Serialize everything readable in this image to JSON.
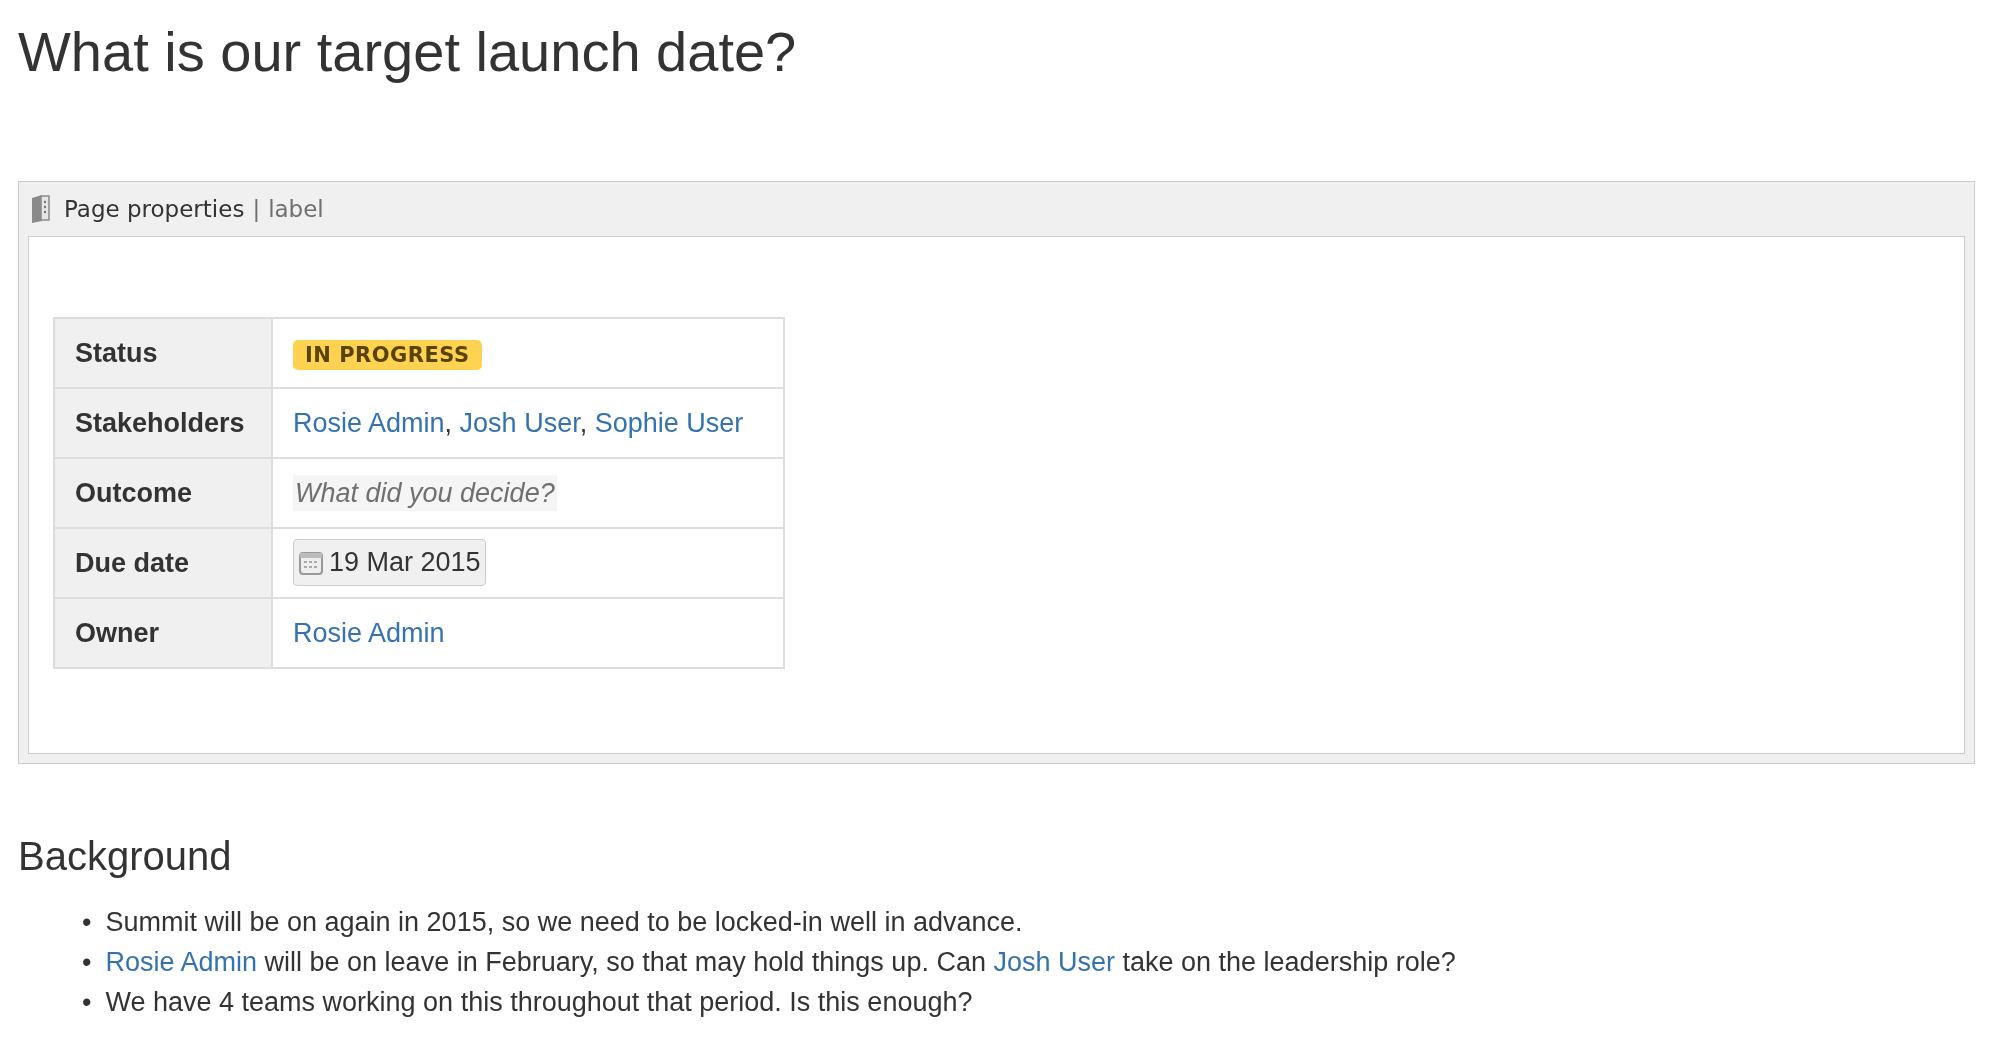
{
  "page_title": "What is our target launch date?",
  "page_properties": {
    "title": "Page properties",
    "separator": "|",
    "label": "label",
    "rows": [
      {
        "label": "Status",
        "kind": "status",
        "value": "IN PROGRESS"
      },
      {
        "label": "Stakeholders",
        "kind": "users",
        "users": [
          "Rosie Admin",
          "Josh User",
          "Sophie User"
        ],
        "separator": ","
      },
      {
        "label": "Outcome",
        "kind": "placeholder",
        "placeholder": "What did you decide?"
      },
      {
        "label": "Due date",
        "kind": "date",
        "value": "19 Mar 2015"
      },
      {
        "label": "Owner",
        "kind": "users",
        "users": [
          "Rosie Admin"
        ]
      }
    ]
  },
  "background": {
    "heading": "Background",
    "marker": "•",
    "bullets": [
      [
        {
          "kind": "text",
          "text": "Summit will be on again in 2015, so we need to be locked-in well in advance."
        }
      ],
      [
        {
          "kind": "user",
          "text": "Rosie Admin"
        },
        {
          "kind": "text",
          "text": " will be on leave in February, so that may hold things up. Can "
        },
        {
          "kind": "user",
          "text": "Josh User"
        },
        {
          "kind": "text",
          "text": " take on the leadership role?"
        }
      ],
      [
        {
          "kind": "text",
          "text": "We have 4 teams working on this throughout that period. Is this enough?"
        }
      ]
    ]
  }
}
